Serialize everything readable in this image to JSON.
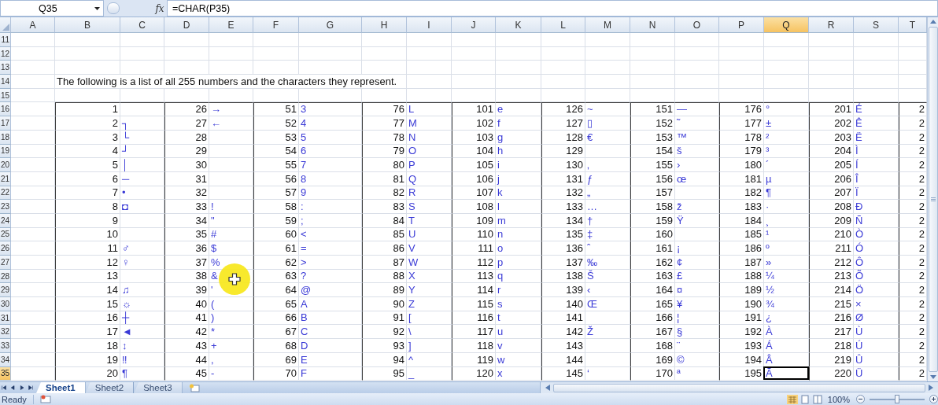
{
  "formula_bar": {
    "name_box": "Q35",
    "function_button": "fx",
    "formula": "=CHAR(P35)"
  },
  "columns": [
    {
      "label": "A",
      "selected": false
    },
    {
      "label": "B",
      "selected": false
    },
    {
      "label": "C",
      "selected": false
    },
    {
      "label": "D",
      "selected": false
    },
    {
      "label": "E",
      "selected": false
    },
    {
      "label": "F",
      "selected": false
    },
    {
      "label": "G",
      "selected": false
    },
    {
      "label": "H",
      "selected": false
    },
    {
      "label": "I",
      "selected": false
    },
    {
      "label": "J",
      "selected": false
    },
    {
      "label": "K",
      "selected": false
    },
    {
      "label": "L",
      "selected": false
    },
    {
      "label": "M",
      "selected": false
    },
    {
      "label": "N",
      "selected": false
    },
    {
      "label": "O",
      "selected": false
    },
    {
      "label": "P",
      "selected": false
    },
    {
      "label": "Q",
      "selected": true
    },
    {
      "label": "R",
      "selected": false
    },
    {
      "label": "S",
      "selected": false
    },
    {
      "label": "T",
      "selected": false
    }
  ],
  "rows": [
    {
      "label": "11",
      "selected": false
    },
    {
      "label": "12",
      "selected": false
    },
    {
      "label": "13",
      "selected": false
    },
    {
      "label": "14",
      "selected": false,
      "text": "The following is a list of all 255 numbers and the characters they represent."
    },
    {
      "label": "15",
      "selected": false
    },
    {
      "label": "16",
      "selected": false
    },
    {
      "label": "17",
      "selected": false
    },
    {
      "label": "18",
      "selected": false
    },
    {
      "label": "19",
      "selected": false
    },
    {
      "label": "20",
      "selected": false
    },
    {
      "label": "21",
      "selected": false
    },
    {
      "label": "22",
      "selected": false
    },
    {
      "label": "23",
      "selected": false
    },
    {
      "label": "24",
      "selected": false
    },
    {
      "label": "25",
      "selected": false
    },
    {
      "label": "26",
      "selected": false
    },
    {
      "label": "27",
      "selected": false
    },
    {
      "label": "28",
      "selected": false
    },
    {
      "label": "29",
      "selected": false
    },
    {
      "label": "30",
      "selected": false
    },
    {
      "label": "31",
      "selected": false
    },
    {
      "label": "32",
      "selected": false
    },
    {
      "label": "33",
      "selected": false
    },
    {
      "label": "34",
      "selected": false
    },
    {
      "label": "35",
      "selected": true
    }
  ],
  "groups": [
    {
      "entries": [
        {
          "number": "1"
        },
        {
          "number": "2",
          "char": "┐"
        },
        {
          "number": "3",
          "char": "└"
        },
        {
          "number": "4",
          "char": "┘"
        },
        {
          "number": "5",
          "char": "│"
        },
        {
          "number": "6",
          "char": "─"
        },
        {
          "number": "7",
          "char": "•"
        },
        {
          "number": "8",
          "char": "◘"
        },
        {
          "number": "9"
        },
        {
          "number": "10"
        },
        {
          "number": "11",
          "char": "♂"
        },
        {
          "number": "12",
          "char": "♀"
        },
        {
          "number": "13"
        },
        {
          "number": "14",
          "char": "♫"
        },
        {
          "number": "15",
          "char": "☼"
        },
        {
          "number": "16",
          "char": "┼"
        },
        {
          "number": "17",
          "char": "◄"
        },
        {
          "number": "18",
          "char": "↕"
        },
        {
          "number": "19",
          "char": "‼"
        },
        {
          "number": "20",
          "char": "¶"
        }
      ]
    },
    {
      "entries": [
        {
          "number": "26",
          "char": "→"
        },
        {
          "number": "27",
          "char": "←"
        },
        {
          "number": "28"
        },
        {
          "number": "29"
        },
        {
          "number": "30"
        },
        {
          "number": "31"
        },
        {
          "number": "32"
        },
        {
          "number": "33",
          "char": "!"
        },
        {
          "number": "34",
          "char": "\""
        },
        {
          "number": "35",
          "char": "#"
        },
        {
          "number": "36",
          "char": "$"
        },
        {
          "number": "37",
          "char": "%"
        },
        {
          "number": "38",
          "char": "&"
        },
        {
          "number": "39",
          "char": "'"
        },
        {
          "number": "40",
          "char": "("
        },
        {
          "number": "41",
          "char": ")"
        },
        {
          "number": "42",
          "char": "*"
        },
        {
          "number": "43",
          "char": "+"
        },
        {
          "number": "44",
          "char": ","
        },
        {
          "number": "45",
          "char": "-"
        }
      ]
    },
    {
      "entries": [
        {
          "number": "51",
          "char": "3"
        },
        {
          "number": "52",
          "char": "4"
        },
        {
          "number": "53",
          "char": "5"
        },
        {
          "number": "54",
          "char": "6"
        },
        {
          "number": "55",
          "char": "7"
        },
        {
          "number": "56",
          "char": "8"
        },
        {
          "number": "57",
          "char": "9"
        },
        {
          "number": "58",
          "char": ":"
        },
        {
          "number": "59",
          "char": ";"
        },
        {
          "number": "60",
          "char": "<"
        },
        {
          "number": "61",
          "char": "="
        },
        {
          "number": "62",
          "char": ">"
        },
        {
          "number": "63",
          "char": "?"
        },
        {
          "number": "64",
          "char": "@"
        },
        {
          "number": "65",
          "char": "A"
        },
        {
          "number": "66",
          "char": "B"
        },
        {
          "number": "67",
          "char": "C"
        },
        {
          "number": "68",
          "char": "D"
        },
        {
          "number": "69",
          "char": "E"
        },
        {
          "number": "70",
          "char": "F"
        }
      ]
    },
    {
      "entries": [
        {
          "number": "76",
          "char": "L"
        },
        {
          "number": "77",
          "char": "M"
        },
        {
          "number": "78",
          "char": "N"
        },
        {
          "number": "79",
          "char": "O"
        },
        {
          "number": "80",
          "char": "P"
        },
        {
          "number": "81",
          "char": "Q"
        },
        {
          "number": "82",
          "char": "R"
        },
        {
          "number": "83",
          "char": "S"
        },
        {
          "number": "84",
          "char": "T"
        },
        {
          "number": "85",
          "char": "U"
        },
        {
          "number": "86",
          "char": "V"
        },
        {
          "number": "87",
          "char": "W"
        },
        {
          "number": "88",
          "char": "X"
        },
        {
          "number": "89",
          "char": "Y"
        },
        {
          "number": "90",
          "char": "Z"
        },
        {
          "number": "91",
          "char": "["
        },
        {
          "number": "92",
          "char": "\\"
        },
        {
          "number": "93",
          "char": "]"
        },
        {
          "number": "94",
          "char": "^"
        },
        {
          "number": "95",
          "char": "_"
        }
      ]
    },
    {
      "entries": [
        {
          "number": "101",
          "char": "e"
        },
        {
          "number": "102",
          "char": "f"
        },
        {
          "number": "103",
          "char": "g"
        },
        {
          "number": "104",
          "char": "h"
        },
        {
          "number": "105",
          "char": "i"
        },
        {
          "number": "106",
          "char": "j"
        },
        {
          "number": "107",
          "char": "k"
        },
        {
          "number": "108",
          "char": "l"
        },
        {
          "number": "109",
          "char": "m"
        },
        {
          "number": "110",
          "char": "n"
        },
        {
          "number": "111",
          "char": "o"
        },
        {
          "number": "112",
          "char": "p"
        },
        {
          "number": "113",
          "char": "q"
        },
        {
          "number": "114",
          "char": "r"
        },
        {
          "number": "115",
          "char": "s"
        },
        {
          "number": "116",
          "char": "t"
        },
        {
          "number": "117",
          "char": "u"
        },
        {
          "number": "118",
          "char": "v"
        },
        {
          "number": "119",
          "char": "w"
        },
        {
          "number": "120",
          "char": "x"
        }
      ]
    },
    {
      "entries": [
        {
          "number": "126",
          "char": "~"
        },
        {
          "number": "127",
          "char": "▯"
        },
        {
          "number": "128",
          "char": "€"
        },
        {
          "number": "129"
        },
        {
          "number": "130",
          "char": "‚"
        },
        {
          "number": "131",
          "char": "ƒ"
        },
        {
          "number": "132",
          "char": "„"
        },
        {
          "number": "133",
          "char": "…"
        },
        {
          "number": "134",
          "char": "†"
        },
        {
          "number": "135",
          "char": "‡"
        },
        {
          "number": "136",
          "char": "ˆ"
        },
        {
          "number": "137",
          "char": "‰"
        },
        {
          "number": "138",
          "char": "Š"
        },
        {
          "number": "139",
          "char": "‹"
        },
        {
          "number": "140",
          "char": "Œ"
        },
        {
          "number": "141"
        },
        {
          "number": "142",
          "char": "Ž"
        },
        {
          "number": "143"
        },
        {
          "number": "144"
        },
        {
          "number": "145",
          "char": "‘"
        }
      ]
    },
    {
      "entries": [
        {
          "number": "151",
          "char": "—"
        },
        {
          "number": "152",
          "char": "˜"
        },
        {
          "number": "153",
          "char": "™"
        },
        {
          "number": "154",
          "char": "š"
        },
        {
          "number": "155",
          "char": "›"
        },
        {
          "number": "156",
          "char": "œ"
        },
        {
          "number": "157"
        },
        {
          "number": "158",
          "char": "ž"
        },
        {
          "number": "159",
          "char": "Ÿ"
        },
        {
          "number": "160"
        },
        {
          "number": "161",
          "char": "¡"
        },
        {
          "number": "162",
          "char": "¢"
        },
        {
          "number": "163",
          "char": "£"
        },
        {
          "number": "164",
          "char": "¤"
        },
        {
          "number": "165",
          "char": "¥"
        },
        {
          "number": "166",
          "char": "¦"
        },
        {
          "number": "167",
          "char": "§"
        },
        {
          "number": "168",
          "char": "¨"
        },
        {
          "number": "169",
          "char": "©"
        },
        {
          "number": "170",
          "char": "ª"
        }
      ]
    },
    {
      "entries": [
        {
          "number": "176",
          "char": "°"
        },
        {
          "number": "177",
          "char": "±"
        },
        {
          "number": "178",
          "char": "²"
        },
        {
          "number": "179",
          "char": "³"
        },
        {
          "number": "180",
          "char": "´"
        },
        {
          "number": "181",
          "char": "µ"
        },
        {
          "number": "182",
          "char": "¶"
        },
        {
          "number": "183",
          "char": "·"
        },
        {
          "number": "184",
          "char": "¸"
        },
        {
          "number": "185",
          "char": "¹"
        },
        {
          "number": "186",
          "char": "º"
        },
        {
          "number": "187",
          "char": "»"
        },
        {
          "number": "188",
          "char": "¼"
        },
        {
          "number": "189",
          "char": "½"
        },
        {
          "number": "190",
          "char": "¾"
        },
        {
          "number": "191",
          "char": "¿"
        },
        {
          "number": "192",
          "char": "À"
        },
        {
          "number": "193",
          "char": "Á"
        },
        {
          "number": "194",
          "char": "Â"
        },
        {
          "number": "195",
          "char": "Ã"
        }
      ]
    },
    {
      "entries": [
        {
          "number": "201",
          "char": "É"
        },
        {
          "number": "202",
          "char": "Ê"
        },
        {
          "number": "203",
          "char": "Ë"
        },
        {
          "number": "204",
          "char": "Ì"
        },
        {
          "number": "205",
          "char": "Í"
        },
        {
          "number": "206",
          "char": "Î"
        },
        {
          "number": "207",
          "char": "Ï"
        },
        {
          "number": "208",
          "char": "Ð"
        },
        {
          "number": "209",
          "char": "Ñ"
        },
        {
          "number": "210",
          "char": "Ò"
        },
        {
          "number": "211",
          "char": "Ó"
        },
        {
          "number": "212",
          "char": "Ô"
        },
        {
          "number": "213",
          "char": "Õ"
        },
        {
          "number": "214",
          "char": "Ö"
        },
        {
          "number": "215",
          "char": "×"
        },
        {
          "number": "216",
          "char": "Ø"
        },
        {
          "number": "217",
          "char": "Ù"
        },
        {
          "number": "218",
          "char": "Ú"
        },
        {
          "number": "219",
          "char": "Û"
        },
        {
          "number": "220",
          "char": "Ü"
        }
      ]
    },
    {
      "entries": [
        {
          "number": "2"
        },
        {
          "number": "2"
        },
        {
          "number": "2"
        },
        {
          "number": "2"
        },
        {
          "number": "2"
        },
        {
          "number": "2"
        },
        {
          "number": "2"
        },
        {
          "number": "2"
        },
        {
          "number": "2"
        },
        {
          "number": "2"
        },
        {
          "number": "2"
        },
        {
          "number": "2"
        },
        {
          "number": "2"
        },
        {
          "number": "2"
        },
        {
          "number": "2"
        },
        {
          "number": "2"
        },
        {
          "number": "2"
        },
        {
          "number": "2"
        },
        {
          "number": "2"
        },
        {
          "number": "2"
        }
      ]
    }
  ],
  "sheet_tabs": [
    {
      "label": "Sheet1",
      "selected": true
    },
    {
      "label": "Sheet2",
      "selected": false
    },
    {
      "label": "Sheet3",
      "selected": false
    }
  ],
  "status_bar": {
    "status": "Ready",
    "zoom": "100%",
    "zoom_slider": {
      "level": 0.5
    }
  }
}
